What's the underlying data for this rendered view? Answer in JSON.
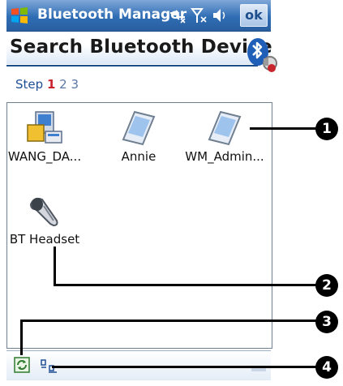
{
  "window": {
    "title": "Bluetooth Manager",
    "ok_label": "ok"
  },
  "header": {
    "title": "Search Bluetooth Device"
  },
  "steps": {
    "label": "Step",
    "current": "1",
    "rest": "2 3"
  },
  "devices": [
    {
      "name": "WANG_DA...",
      "icon": "computer-icon"
    },
    {
      "name": "Annie",
      "icon": "pda-icon"
    },
    {
      "name": "WM_Admin...",
      "icon": "pda-icon"
    },
    {
      "name": "BT Headset",
      "icon": "headset-icon"
    }
  ],
  "callouts": [
    "1",
    "2",
    "3",
    "4"
  ],
  "colors": {
    "titlebar": "#2f6db4",
    "header_line": "#1c4d86",
    "step_current": "#c8242b"
  }
}
